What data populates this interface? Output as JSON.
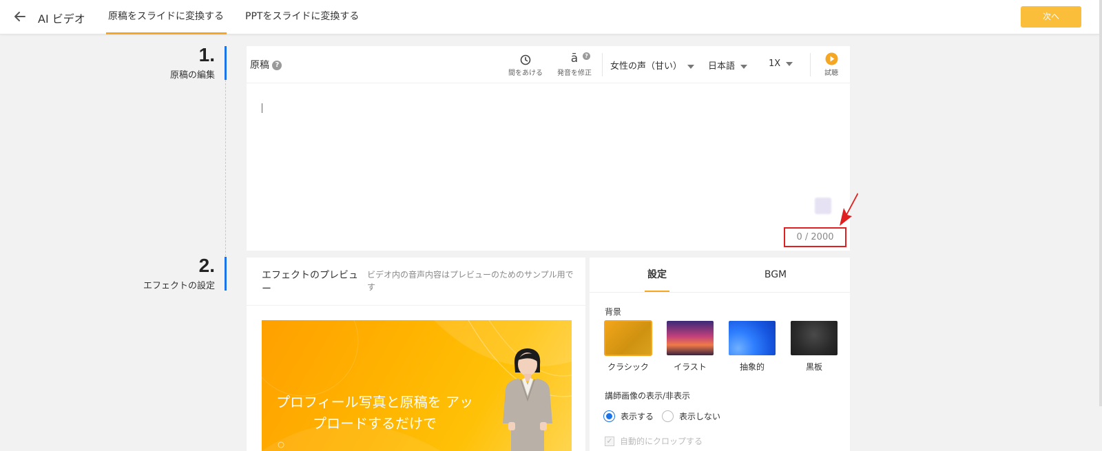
{
  "header": {
    "app_title": "AI ビデオ",
    "tabs": [
      {
        "label": "原稿をスライドに変換する",
        "active": true
      },
      {
        "label": "PPTをスライドに変換する",
        "active": false
      }
    ],
    "next_label": "次へ",
    "accent_color": "#f5a623"
  },
  "steps": [
    {
      "number": "1.",
      "label": "原稿の編集"
    },
    {
      "number": "2.",
      "label": "エフェクトの設定"
    }
  ],
  "script": {
    "title": "原稿",
    "help": "?",
    "tools": {
      "pause_label": "間をあける",
      "pronunciation_label": "発音を修正",
      "pronunciation_glyph": "ā",
      "play_label": "試聴"
    },
    "voice": "女性の声（甘い）",
    "language": "日本語",
    "speed": "1X",
    "value": "",
    "counter": "0 / 2000"
  },
  "preview": {
    "title": "エフェクトのプレビュー",
    "note": "ビデオ内の音声内容はプレビューのためのサンプル用です",
    "video_text": "プロフィール写真と原稿を アップロードするだけで"
  },
  "settings": {
    "tabs": [
      {
        "label": "設定",
        "active": true
      },
      {
        "label": "BGM",
        "active": false
      }
    ],
    "background_label": "背景",
    "backgrounds": [
      {
        "name": "クラシック",
        "selected": true
      },
      {
        "name": "イラスト",
        "selected": false
      },
      {
        "name": "抽象的",
        "selected": false
      },
      {
        "name": "黒板",
        "selected": false
      }
    ],
    "presenter_label": "講師画像の表示/非表示",
    "show_label": "表示する",
    "hide_label": "表示しない",
    "show_selected": true,
    "auto_crop_label": "自動的にクロップする",
    "auto_crop_checked": true
  }
}
